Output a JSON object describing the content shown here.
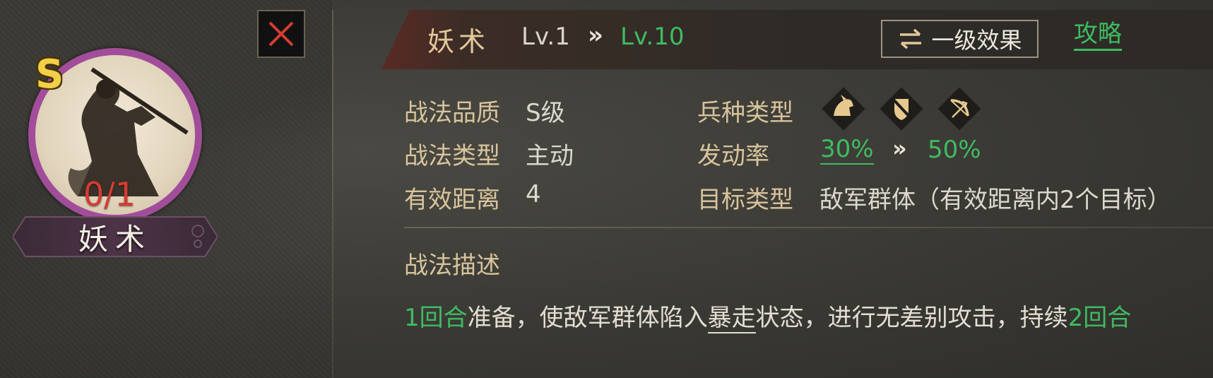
{
  "portrait": {
    "grade": "S",
    "count": "0/1",
    "name": "妖术",
    "ring_color": "#a24d9a"
  },
  "close_button": {
    "icon": "close-icon",
    "color": "#d33c33"
  },
  "header": {
    "skill_name": "妖术",
    "level_from": "Lv.1",
    "level_arrow": "»",
    "level_to": "Lv.10",
    "effect_button": {
      "icon": "swap-icon",
      "label": "一级效果"
    },
    "guide_label": "攻略"
  },
  "attributes": {
    "quality": {
      "label": "战法品质",
      "value": "S级"
    },
    "type": {
      "label": "战法类型",
      "value": "主动"
    },
    "range": {
      "label": "有效距离",
      "value": "4"
    },
    "troop": {
      "label": "兵种类型",
      "icons": [
        "cavalry-icon",
        "shield-icon",
        "bow-icon"
      ]
    },
    "activation": {
      "label": "发动率",
      "from": "30%",
      "arrow": "»",
      "to": "50%"
    },
    "target": {
      "label": "目标类型",
      "value": "敌军群体（有效距离内2个目标）"
    }
  },
  "description": {
    "title": "战法描述",
    "parts": {
      "p1": "1回合",
      "p2": "准备，使敌军群体陷入",
      "p3": "暴走",
      "p4": "状态，进行无差别攻击，持续",
      "p5": "2回合"
    }
  },
  "colors": {
    "accent_green": "#3fbb62",
    "label_gold": "#d8c49c",
    "grade_yellow": "#f1cf48",
    "count_red": "#d33c33"
  }
}
